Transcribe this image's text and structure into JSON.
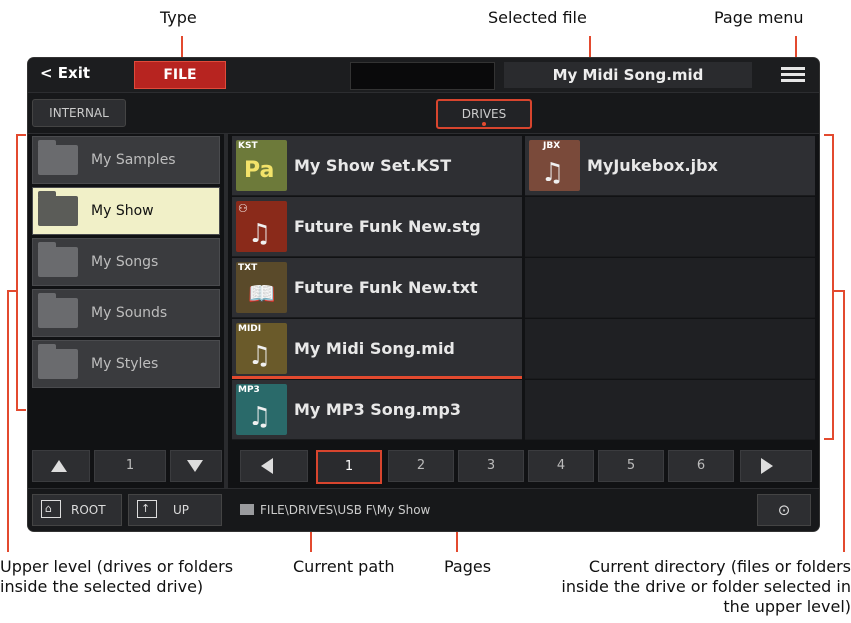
{
  "callouts": {
    "type": "Type",
    "selected_file": "Selected file",
    "page_menu": "Page menu",
    "upper_level": "Upper level (drives or folders inside the selected drive)",
    "current_path": "Current path",
    "pages": "Pages",
    "current_directory": "Current directory (files or folders inside the drive or folder selected in the upper level)"
  },
  "header": {
    "exit_label": "< Exit",
    "type_button": "FILE",
    "selected_file": "My Midi Song.mid"
  },
  "tabs": {
    "internal": "INTERNAL",
    "drives": "DRIVES"
  },
  "folders": [
    {
      "label": "My Samples",
      "selected": false
    },
    {
      "label": "My Show",
      "selected": true
    },
    {
      "label": "My Songs",
      "selected": false
    },
    {
      "label": "My Sounds",
      "selected": false
    },
    {
      "label": "My Styles",
      "selected": false
    }
  ],
  "files": [
    {
      "tag": "KST",
      "name": "My Show Set.KST",
      "thumb_color": "#6d7a3a"
    },
    {
      "tag": "JBX",
      "name": "MyJukebox.jbx",
      "thumb_color": "#7a4a3a"
    },
    {
      "tag": "",
      "name": "Future Funk New.stg",
      "thumb_color": "#8a2a1a"
    },
    {
      "tag": "TXT",
      "name": "Future Funk New.txt",
      "thumb_color": "#5a4a2a"
    },
    {
      "tag": "MIDI",
      "name": "My Midi Song.mid",
      "thumb_color": "#6a5a2a"
    },
    {
      "tag": "MP3",
      "name": "My MP3 Song.mp3",
      "thumb_color": "#2a6a6a"
    }
  ],
  "left_nav": {
    "page": "1"
  },
  "pages": [
    "1",
    "2",
    "3",
    "4",
    "5",
    "6"
  ],
  "current_page": "1",
  "bottom": {
    "root_label": "ROOT",
    "up_label": "UP",
    "path": "FILE\\DRIVES\\USB F\\My Show"
  },
  "colors": {
    "accent": "#e34a2f",
    "type_button": "#b72420",
    "selected_folder": "#f1f0c8"
  }
}
